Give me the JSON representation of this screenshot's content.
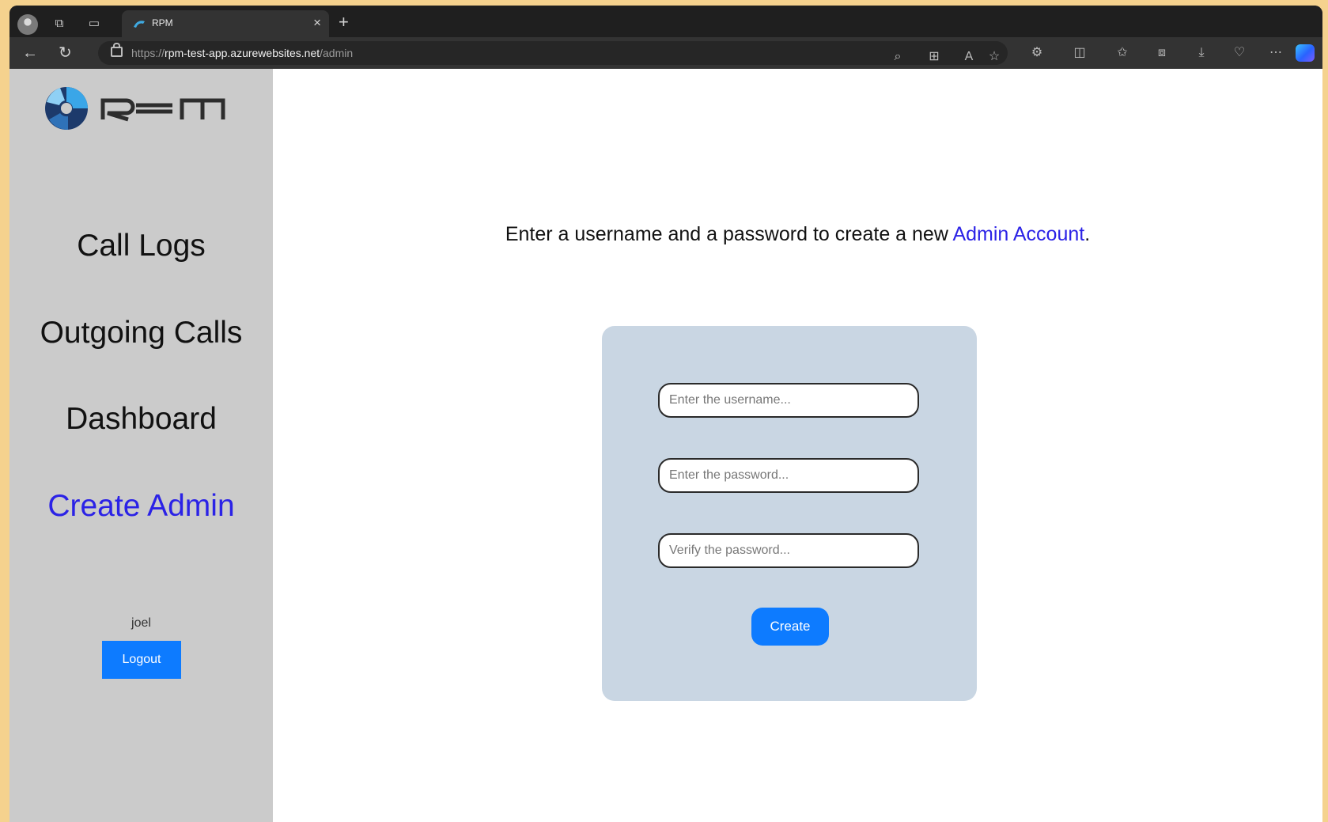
{
  "browser": {
    "tab_title": "RPM",
    "tab_close": "×",
    "new_tab": "+",
    "url_scheme": "https://",
    "url_host": "rpm-test-app.azurewebsites.net",
    "url_path": "/admin"
  },
  "sidebar": {
    "nav": [
      {
        "label": "Call Logs",
        "active": false
      },
      {
        "label": "Outgoing Calls",
        "active": false
      },
      {
        "label": "Dashboard",
        "active": false
      },
      {
        "label": "Create Admin",
        "active": true
      }
    ],
    "username": "joel",
    "logout_label": "Logout"
  },
  "main": {
    "intro_text": "Enter a username and a password to create a new ",
    "intro_highlight": "Admin Account",
    "intro_end": ".",
    "form": {
      "username_placeholder": "Enter the username...",
      "password_placeholder": "Enter the password...",
      "verify_placeholder": "Verify the password...",
      "create_label": "Create"
    }
  },
  "colors": {
    "accent_link": "#2b22e6",
    "button_blue": "#0d7bff",
    "sidebar_bg": "#cbcbcb",
    "card_bg": "#c9d6e3"
  }
}
